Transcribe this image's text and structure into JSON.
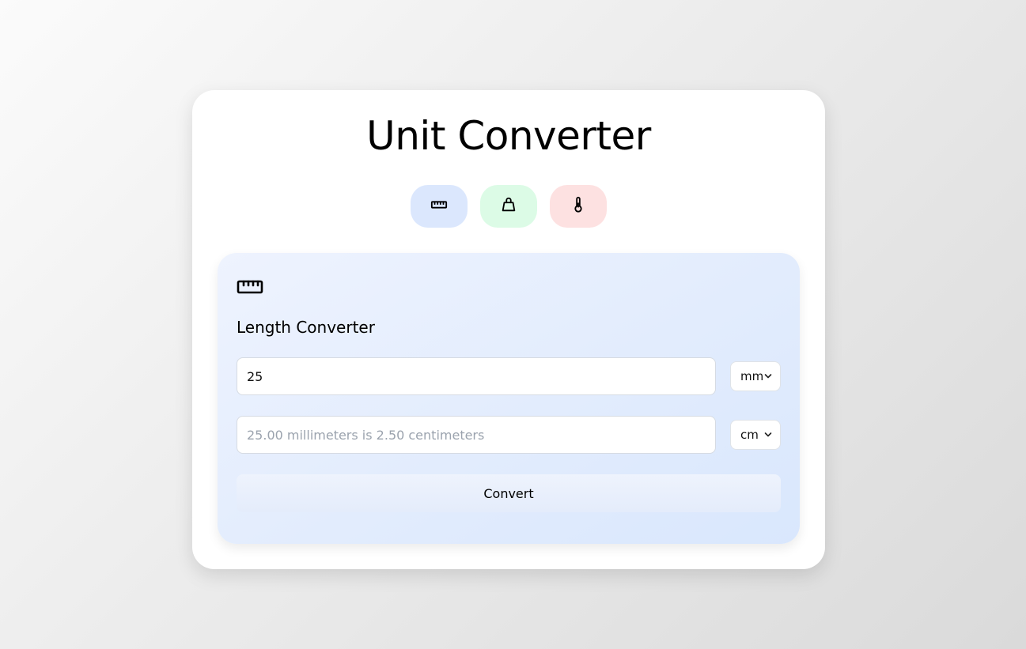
{
  "app": {
    "title": "Unit Converter"
  },
  "tabs": [
    {
      "icon": "ruler-icon",
      "color": "#dbe7fd"
    },
    {
      "icon": "weight-icon",
      "color": "#dcfbe6"
    },
    {
      "icon": "thermometer-icon",
      "color": "#fde1e1"
    }
  ],
  "converter": {
    "icon": "ruler-icon",
    "title": "Length Converter",
    "input_value": "25",
    "from_unit": "mm",
    "result_placeholder": "25.00 millimeters is 2.50 centimeters",
    "to_unit": "cm",
    "convert_label": "Convert"
  },
  "colors": {
    "card": "#ffffff",
    "panel": "#e2ecfd",
    "field_border": "#d6dbe3",
    "placeholder": "#9ba3ae"
  }
}
